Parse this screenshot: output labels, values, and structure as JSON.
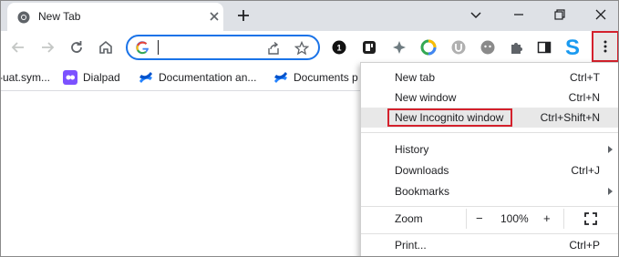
{
  "tab": {
    "title": "New Tab",
    "favicon": "chrome-icon"
  },
  "toolbar": {
    "omnibox_value": "",
    "icons": [
      "back-icon",
      "forward-icon",
      "reload-icon",
      "home-icon"
    ]
  },
  "bookmarks": [
    {
      "label": "-uat.sym...",
      "icon": "none"
    },
    {
      "label": "Dialpad",
      "icon": "dialpad-icon"
    },
    {
      "label": "Documentation an...",
      "icon": "confluence-icon"
    },
    {
      "label": "Documents p",
      "icon": "confluence-icon"
    }
  ],
  "menu": {
    "items": [
      {
        "label": "New tab",
        "shortcut": "Ctrl+T"
      },
      {
        "label": "New window",
        "shortcut": "Ctrl+N"
      },
      {
        "label": "New Incognito window",
        "shortcut": "Ctrl+Shift+N"
      },
      {
        "label": "History",
        "shortcut": ""
      },
      {
        "label": "Downloads",
        "shortcut": "Ctrl+J"
      },
      {
        "label": "Bookmarks",
        "shortcut": ""
      },
      {
        "label": "Zoom",
        "shortcut": ""
      },
      {
        "label": "Print...",
        "shortcut": "Ctrl+P"
      }
    ],
    "zoom": {
      "minus": "−",
      "value": "100%",
      "plus": "+"
    }
  },
  "colors": {
    "highlight_red": "#d4212c",
    "accent_blue": "#1a73e8",
    "tabstrip": "#dee1e6"
  }
}
